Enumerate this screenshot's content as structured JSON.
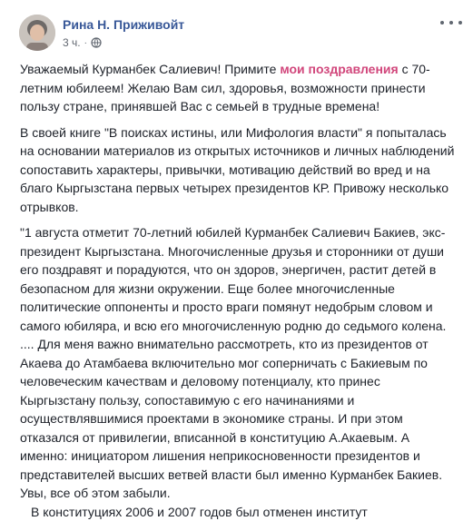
{
  "post": {
    "author_name": "Рина Н. Приживойт",
    "timestamp": "3 ч.",
    "separator": "·",
    "privacy_icon": "globe-icon",
    "more_icon": "more-options-icon",
    "greeting_part1": "Уважаемый Курманбек Салиевич! Примите ",
    "greeting_highlight": "мои поздравления",
    "greeting_part2": " с 70-летним юбилеем! Желаю Вам сил, здоровья, возможности принести пользу стране, принявшей Вас с семьей в трудные времена!",
    "paragraph2": "В своей книге \"В поисках истины, или Мифология власти\" я попыталась на основании материалов из открытых источников и личных наблюдений сопоставить характеры, привычки, мотивацию действий во вред и на благо Кыргызстана первых четырех президентов КР. Привожу несколько отрывков.",
    "paragraph3": "\"1 августа отметит 70-летний юбилей Курманбек Салиевич Бакиев, экс-президент Кыргызстана. Многочисленные друзья и сторонники от души его поздравят и порадуются, что он здоров, энергичен, растит детей в безопасном для жизни окружении. Еще более многочисленные политические оппоненты и просто враги помянут недобрым словом и самого юбиляра, и всю его многочисленную родню до седьмого колена.",
    "paragraph4": ".... Для меня важно внимательно рассмотреть, кто из президентов от Акаева до Атамбаева включительно мог соперничать с Бакиевым по человеческим качествам и деловому потенциалу, кто принес Кыргызстану пользу, сопоставимую с его начинаниями и осуществлявшимися проектами в экономике страны. И при этом отказался от привилегии, вписанной в конституцию А.Акаевым. А именно: инициатором лишения неприкосновенности президентов и представителей высших ветвей власти был именно Курманбек Бакиев. Увы, все об этом забыли.",
    "paragraph5": "В конституциях 2006 и 2007 годов был отменен институт"
  },
  "colors": {
    "author": "#385898",
    "highlight": "#d1467b",
    "text": "#1d2129",
    "meta": "#616770"
  }
}
